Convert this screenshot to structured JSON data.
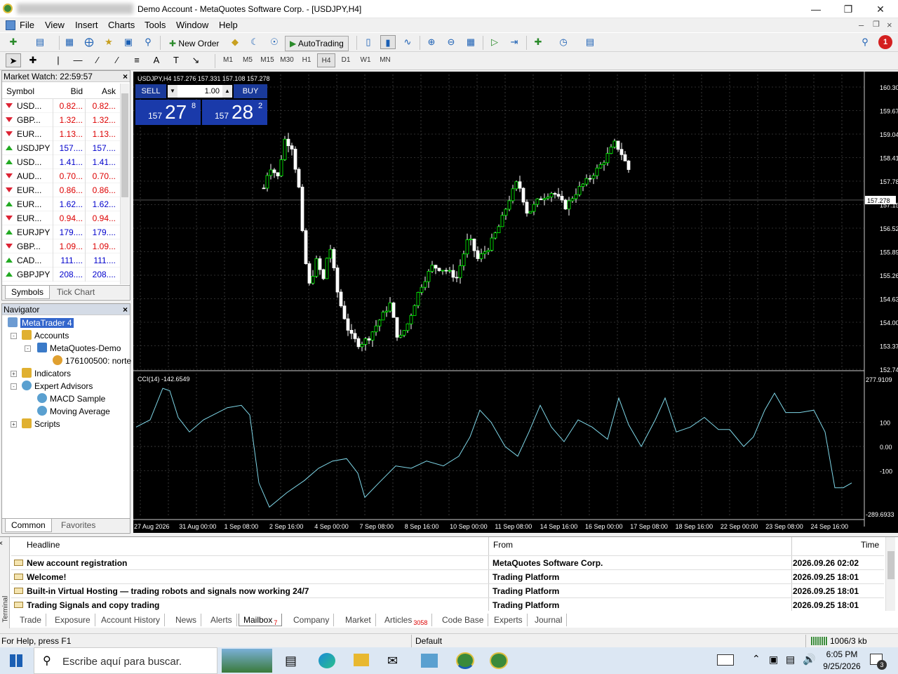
{
  "window": {
    "title": "Demo Account - MetaQuotes Software Corp. - [USDJPY,H4]"
  },
  "menu": [
    "File",
    "View",
    "Insert",
    "Charts",
    "Tools",
    "Window",
    "Help"
  ],
  "toolbar": {
    "new_order": "New Order",
    "autotrading": "AutoTrading",
    "notification_count": "1"
  },
  "timeframes": [
    "M1",
    "M5",
    "M15",
    "M30",
    "H1",
    "H4",
    "D1",
    "W1",
    "MN"
  ],
  "active_timeframe": "H4",
  "market_watch": {
    "title": "Market Watch: 22:59:57",
    "headers": {
      "symbol": "Symbol",
      "bid": "Bid",
      "ask": "Ask"
    },
    "rows": [
      {
        "symbol": "USD...",
        "bid": "0.82...",
        "ask": "0.82...",
        "dir": "down"
      },
      {
        "symbol": "GBP...",
        "bid": "1.32...",
        "ask": "1.32...",
        "dir": "down"
      },
      {
        "symbol": "EUR...",
        "bid": "1.13...",
        "ask": "1.13...",
        "dir": "down"
      },
      {
        "symbol": "USDJPY",
        "bid": "157....",
        "ask": "157....",
        "dir": "up"
      },
      {
        "symbol": "USD...",
        "bid": "1.41...",
        "ask": "1.41...",
        "dir": "up"
      },
      {
        "symbol": "AUD...",
        "bid": "0.70...",
        "ask": "0.70...",
        "dir": "down"
      },
      {
        "symbol": "EUR...",
        "bid": "0.86...",
        "ask": "0.86...",
        "dir": "down"
      },
      {
        "symbol": "EUR...",
        "bid": "1.62...",
        "ask": "1.62...",
        "dir": "up"
      },
      {
        "symbol": "EUR...",
        "bid": "0.94...",
        "ask": "0.94...",
        "dir": "down"
      },
      {
        "symbol": "EURJPY",
        "bid": "179....",
        "ask": "179....",
        "dir": "up"
      },
      {
        "symbol": "GBP...",
        "bid": "1.09...",
        "ask": "1.09...",
        "dir": "down"
      },
      {
        "symbol": "CAD...",
        "bid": "111....",
        "ask": "111....",
        "dir": "up"
      },
      {
        "symbol": "GBPJPY",
        "bid": "208....",
        "ask": "208....",
        "dir": "up"
      }
    ],
    "tabs": [
      "Symbols",
      "Tick Chart"
    ]
  },
  "navigator": {
    "title": "Navigator",
    "items": [
      "MetaTrader 4",
      "Accounts",
      "MetaQuotes-Demo",
      "176100500: norte",
      "Indicators",
      "Expert Advisors",
      "MACD Sample",
      "Moving Average",
      "Scripts"
    ],
    "tabs": [
      "Common",
      "Favorites"
    ]
  },
  "chart": {
    "header": "USDJPY,H4  157.276 157.331 157.108 157.278",
    "one_click": {
      "sell": "SELL",
      "buy": "BUY",
      "lot": "1.00",
      "sell_big": "157",
      "sell_mid": "27",
      "sell_sup": "8",
      "buy_big": "157",
      "buy_mid": "28",
      "buy_sup": "2"
    },
    "price_labels": [
      "160.305",
      "159.675",
      "159.045",
      "158.415",
      "157.785",
      "157.278",
      "157.155",
      "156.525",
      "155.895",
      "155.265",
      "154.635",
      "154.005",
      "153.375",
      "152.745"
    ],
    "current_price": "157.278",
    "cci_label": "CCI(14) -142.6549",
    "cci_labels": [
      "277.9109",
      "100",
      "0.00",
      "-100",
      "-289.6933"
    ],
    "time_labels": [
      "27 Aug 2026",
      "31 Aug 00:00",
      "1 Sep 08:00",
      "2 Sep 16:00",
      "4 Sep 00:00",
      "7 Sep 08:00",
      "8 Sep 16:00",
      "10 Sep 00:00",
      "11 Sep 08:00",
      "14 Sep 16:00",
      "16 Sep 00:00",
      "17 Sep 08:00",
      "18 Sep 16:00",
      "22 Sep 00:00",
      "23 Sep 08:00",
      "24 Sep 16:00"
    ],
    "bull_color": "#00ff00",
    "line_color": "#7fd7e8"
  },
  "terminal": {
    "side_label": "Terminal",
    "headers": {
      "headline": "Headline",
      "from": "From",
      "time": "Time"
    },
    "rows": [
      {
        "headline": "New account registration",
        "from": "MetaQuotes Software Corp.",
        "time": "2026.09.26 02:02"
      },
      {
        "headline": "Welcome!",
        "from": "Trading Platform",
        "time": "2026.09.25 18:01"
      },
      {
        "headline": "Built-in Virtual Hosting — trading robots and signals now working 24/7",
        "from": "Trading Platform",
        "time": "2026.09.25 18:01"
      },
      {
        "headline": "Trading Signals and copy trading",
        "from": "Trading Platform",
        "time": "2026.09.25 18:01"
      }
    ],
    "tabs": [
      {
        "label": "Trade",
        "badge": ""
      },
      {
        "label": "Exposure",
        "badge": ""
      },
      {
        "label": "Account History",
        "badge": ""
      },
      {
        "label": "News",
        "badge": ""
      },
      {
        "label": "Alerts",
        "badge": ""
      },
      {
        "label": "Mailbox",
        "badge": "7"
      },
      {
        "label": "Company",
        "badge": ""
      },
      {
        "label": "Market",
        "badge": ""
      },
      {
        "label": "Articles",
        "badge": "3058"
      },
      {
        "label": "Code Base",
        "badge": ""
      },
      {
        "label": "Experts",
        "badge": ""
      },
      {
        "label": "Journal",
        "badge": ""
      }
    ],
    "active_tab": "Mailbox"
  },
  "status": {
    "help": "For Help, press F1",
    "profile": "Default",
    "traffic": "1006/3 kb"
  },
  "taskbar": {
    "search_placeholder": "Escribe aquí para buscar.",
    "time": "6:05 PM",
    "date": "9/25/2026",
    "notifications": "3"
  }
}
